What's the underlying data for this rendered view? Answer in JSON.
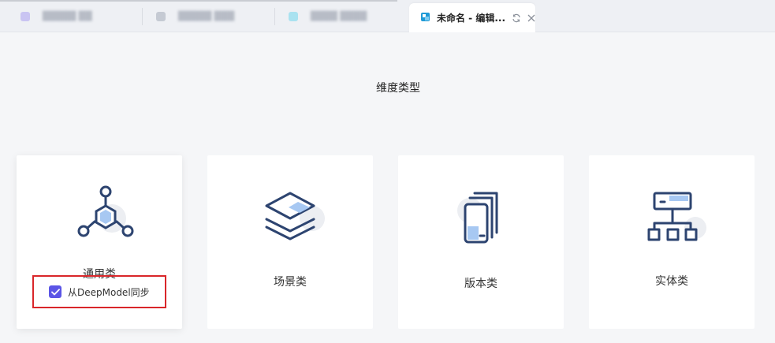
{
  "tabs": [
    {
      "label": "",
      "favicon_color": "#c9c4f2"
    },
    {
      "label": "",
      "favicon_color": "#c5cad3"
    },
    {
      "label": "",
      "favicon_color": "#a9e2f0"
    },
    {
      "label": "未命名 - 编辑...",
      "favicon_color": "#1f9ad6",
      "active": true
    }
  ],
  "main": {
    "title": "维度类型",
    "cards": [
      {
        "label": "通用类",
        "icon": "hexagon-network-icon",
        "selected": true
      },
      {
        "label": "场景类",
        "icon": "layers-stack-icon",
        "selected": false
      },
      {
        "label": "版本类",
        "icon": "document-copies-icon",
        "selected": false
      },
      {
        "label": "实体类",
        "icon": "org-chart-icon",
        "selected": false
      }
    ],
    "sync_checkbox": {
      "label": "从DeepModel同步",
      "checked": true
    }
  },
  "colors": {
    "accent": "#5b55e6",
    "icon_stroke": "#2d4470",
    "icon_fill": "#a7c8f2",
    "highlight_border": "#d9262a"
  }
}
